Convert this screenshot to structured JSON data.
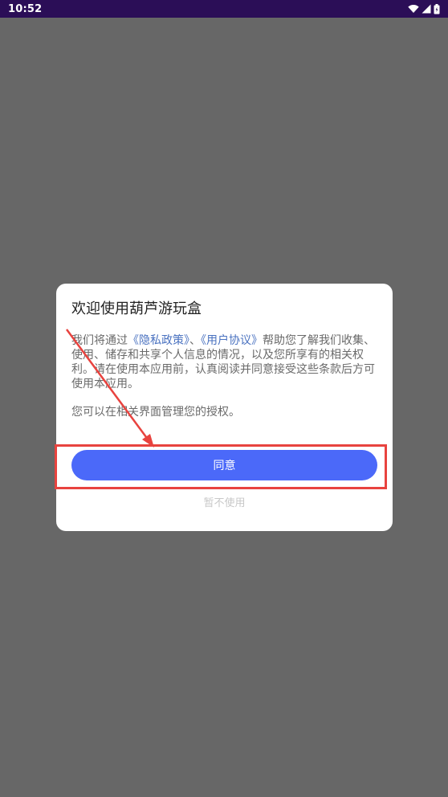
{
  "status_bar": {
    "time": "10:52",
    "icons": [
      "wifi-icon",
      "signal-icon",
      "battery-icon"
    ]
  },
  "dialog": {
    "title": "欢迎使用葫芦游玩盒",
    "body": {
      "prefix": "我们将通过",
      "privacy_link": "《隐私政策》",
      "separator": "、",
      "agreement_link": "《用户协议》",
      "suffix": "帮助您了解我们收集、使用、储存和共享个人信息的情况，以及您所享有的相关权利。请在使用本应用前，认真阅读并同意接受这些条款后方可使用本应用。"
    },
    "note": "您可以在相关界面管理您的授权。",
    "agree_label": "同意",
    "decline_label": "暂不使用"
  },
  "colors": {
    "status_bar": "#2b0e57",
    "backdrop": "#676767",
    "primary_button": "#4b69f9",
    "link": "#4a72c0",
    "annotation": "#e8433f"
  }
}
